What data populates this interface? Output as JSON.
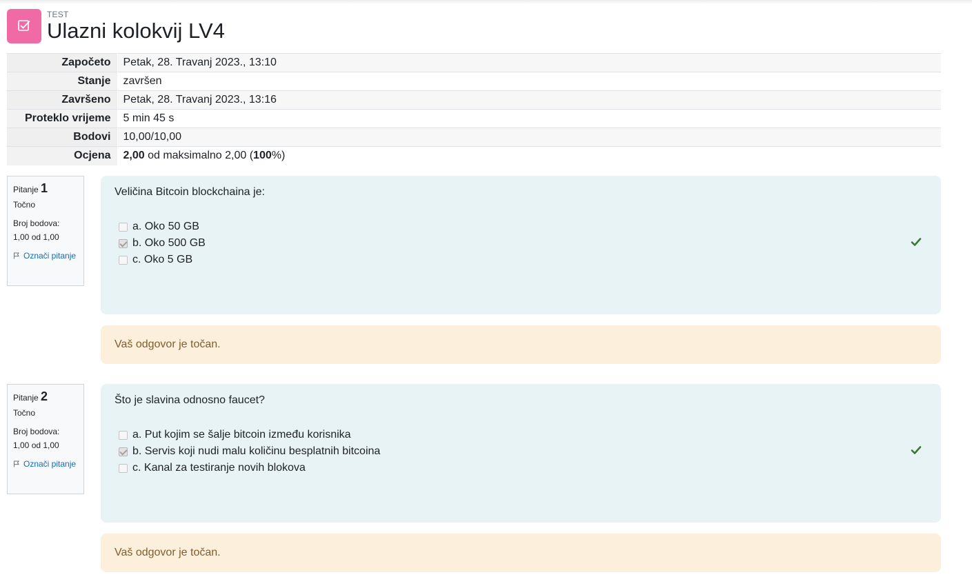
{
  "header": {
    "activity_type": "TEST",
    "title": "Ulazni kolokvij LV4",
    "icon": "quiz-checkbox-icon",
    "icon_color": "#f06aa6"
  },
  "summary": {
    "rows": [
      {
        "label": "Započeto",
        "value": "Petak, 28. Travanj 2023., 13:10"
      },
      {
        "label": "Stanje",
        "value": "završen"
      },
      {
        "label": "Završeno",
        "value": "Petak, 28. Travanj 2023., 13:16"
      },
      {
        "label": "Proteklo vrijeme",
        "value": "5 min 45 s"
      },
      {
        "label": "Bodovi",
        "value": "10,00/10,00"
      }
    ],
    "grade": {
      "label": "Ocjena",
      "score": "2,00",
      "middle": " od maksimalno 2,00 (",
      "percent": "100",
      "end": "%)"
    }
  },
  "questions": [
    {
      "prefix": "Pitanje",
      "number": "1",
      "state": "Točno",
      "grade_label": "Broj bodova:",
      "grade_value": "1,00 od 1,00",
      "flag_label": "Označi pitanje",
      "text": "Veličina Bitcoin blockchaina je:",
      "answers": [
        {
          "label": "a. Oko 50 GB",
          "checked": false
        },
        {
          "label": "b. Oko 500 GB",
          "checked": true
        },
        {
          "label": "c. Oko 5 GB",
          "checked": false
        }
      ],
      "feedback": "Vaš odgovor je točan."
    },
    {
      "prefix": "Pitanje",
      "number": "2",
      "state": "Točno",
      "grade_label": "Broj bodova:",
      "grade_value": "1,00 od 1,00",
      "flag_label": "Označi pitanje",
      "text": "Što je slavina odnosno faucet?",
      "answers": [
        {
          "label": "a. Put kojim se šalje bitcoin između korisnika",
          "checked": false
        },
        {
          "label": "b. Servis koji nudi malu količinu besplatnih bitcoina",
          "checked": true
        },
        {
          "label": "c. Kanal za testiranje novih blokova",
          "checked": false
        }
      ],
      "feedback": "Vaš odgovor je točan."
    }
  ],
  "colors": {
    "formulation_bg": "#e7f3f5",
    "feedback_bg": "#fcefdc",
    "correct_green": "#357a32",
    "link_blue": "#0f6cbf"
  }
}
